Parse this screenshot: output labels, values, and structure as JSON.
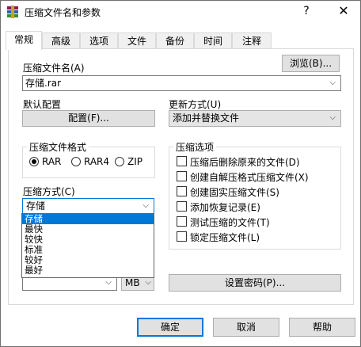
{
  "window": {
    "title": "压缩文件名和参数",
    "help_glyph": "?",
    "close_glyph": "✕"
  },
  "tabs": [
    {
      "label": "常规"
    },
    {
      "label": "高级"
    },
    {
      "label": "选项"
    },
    {
      "label": "文件"
    },
    {
      "label": "备份"
    },
    {
      "label": "时间"
    },
    {
      "label": "注释"
    }
  ],
  "archive_name": {
    "label": "压缩文件名(A)",
    "value": "存储.rar",
    "browse_label": "浏览(B)..."
  },
  "default_profile": {
    "label": "默认配置",
    "button_label": "配置(F)..."
  },
  "update_mode": {
    "label": "更新方式(U)",
    "value": "添加并替换文件"
  },
  "archive_format": {
    "title": "压缩文件格式",
    "options": [
      "RAR",
      "RAR4",
      "ZIP"
    ],
    "selected": "RAR"
  },
  "compression_method": {
    "label": "压缩方式(C)",
    "value": "存储",
    "options": [
      "存储",
      "最快",
      "较快",
      "标准",
      "较好",
      "最好"
    ],
    "highlighted": "存储"
  },
  "split": {
    "unit": "MB"
  },
  "archive_options": {
    "title": "压缩选项",
    "items": [
      "压缩后删除原来的文件(D)",
      "创建自解压格式压缩文件(X)",
      "创建固实压缩文件(S)",
      "添加恢复记录(E)",
      "测试压缩的文件(T)",
      "锁定压缩文件(L)"
    ]
  },
  "password_button": "设置密码(P)...",
  "footer": {
    "ok": "确定",
    "cancel": "取消",
    "help": "帮助"
  },
  "colors": {
    "selection": "#0078d7",
    "button_face": "#e1e1e1"
  }
}
